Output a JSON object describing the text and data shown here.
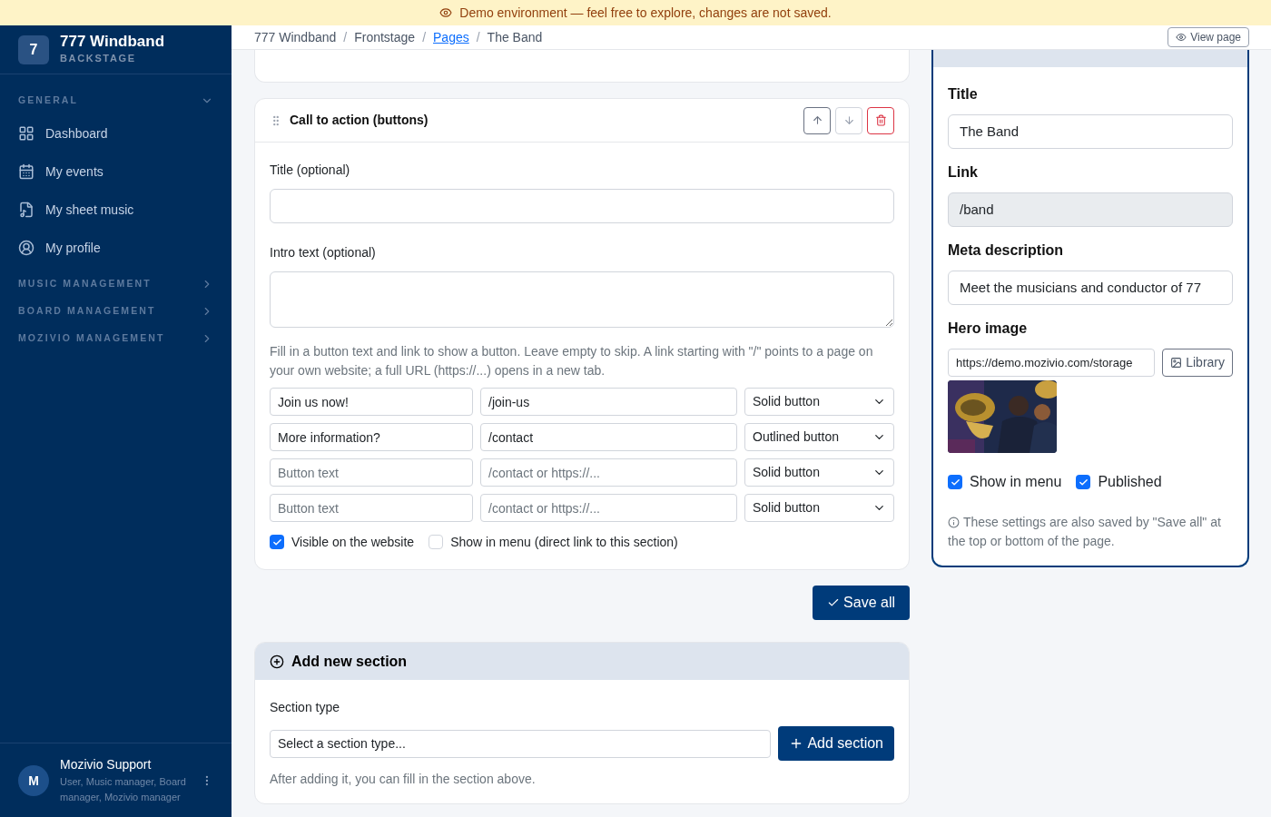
{
  "banner": {
    "text": "Demo environment — feel free to explore, changes are not saved."
  },
  "sidebar": {
    "logo_letter": "7",
    "brand": "777 Windband",
    "subtitle": "BACKSTAGE",
    "sections": [
      {
        "title": "GENERAL",
        "expanded": true,
        "items": [
          {
            "label": "Dashboard"
          },
          {
            "label": "My events"
          },
          {
            "label": "My sheet music"
          },
          {
            "label": "My profile"
          }
        ]
      },
      {
        "title": "MUSIC MANAGEMENT",
        "expanded": false
      },
      {
        "title": "BOARD MANAGEMENT",
        "expanded": false
      },
      {
        "title": "MOZIVIO MANAGEMENT",
        "expanded": false
      }
    ],
    "user": {
      "initial": "M",
      "name": "Mozivio Support",
      "roles": "User, Music manager, Board manager, Mozivio manager"
    }
  },
  "breadcrumb": [
    {
      "kind": "crumb",
      "label": "777 Windband",
      "link": false
    },
    {
      "kind": "separator",
      "label": "/"
    },
    {
      "kind": "crumb",
      "label": "Frontstage",
      "link": false
    },
    {
      "kind": "separator",
      "label": "/"
    },
    {
      "kind": "crumb",
      "label": "Pages",
      "link": true
    },
    {
      "kind": "separator",
      "label": "/"
    },
    {
      "kind": "crumb",
      "label": "The Band",
      "link": false
    }
  ],
  "view_page": "View page",
  "section": {
    "title": "Call to action (buttons)",
    "move_up_disabled": false,
    "move_down_disabled": true,
    "fields": [
      {
        "label": "Title (optional)",
        "kind": "input"
      },
      {
        "label": "Intro text (optional)",
        "kind": "textarea"
      }
    ],
    "help": "Fill in a button text and link to show a button. Leave empty to skip. A link starting with \"/\" points to a page on your own website; a full URL (https://...) opens in a new tab.",
    "buttons": [
      {
        "text": "Join us now!",
        "link": "/join-us",
        "style": "Solid button"
      },
      {
        "text": "More information?",
        "link": "/contact",
        "style": "Outlined button"
      },
      {
        "text_placeholder": "Button text",
        "link_placeholder": "/contact or https://...",
        "style": "Solid button"
      },
      {
        "text_placeholder": "Button text",
        "link_placeholder": "/contact or https://...",
        "style": "Solid button"
      }
    ],
    "checkboxes": [
      {
        "label": "Visible on the website",
        "checked": true
      },
      {
        "label": "Show in menu (direct link to this section)",
        "checked": false
      }
    ]
  },
  "save_all": "Save all",
  "add_section": {
    "title": "Add new section",
    "label": "Section type",
    "placeholder": "Select a section type...",
    "button": "Add section",
    "note": "After adding it, you can fill in the section above."
  },
  "settings": {
    "title_label": "Title",
    "title_value": "The Band",
    "link_label": "Link",
    "link_value": "/band",
    "meta_label": "Meta description",
    "meta_value": "Meet the musicians and conductor of 77",
    "hero_label": "Hero image",
    "hero_value": "https://demo.mozivio.com/storage",
    "library": "Library",
    "checkboxes": [
      {
        "label": "Show in menu",
        "checked": true
      },
      {
        "label": "Published",
        "checked": true
      }
    ],
    "note": "These settings are also saved by \"Save all\" at the top or bottom of the page."
  }
}
